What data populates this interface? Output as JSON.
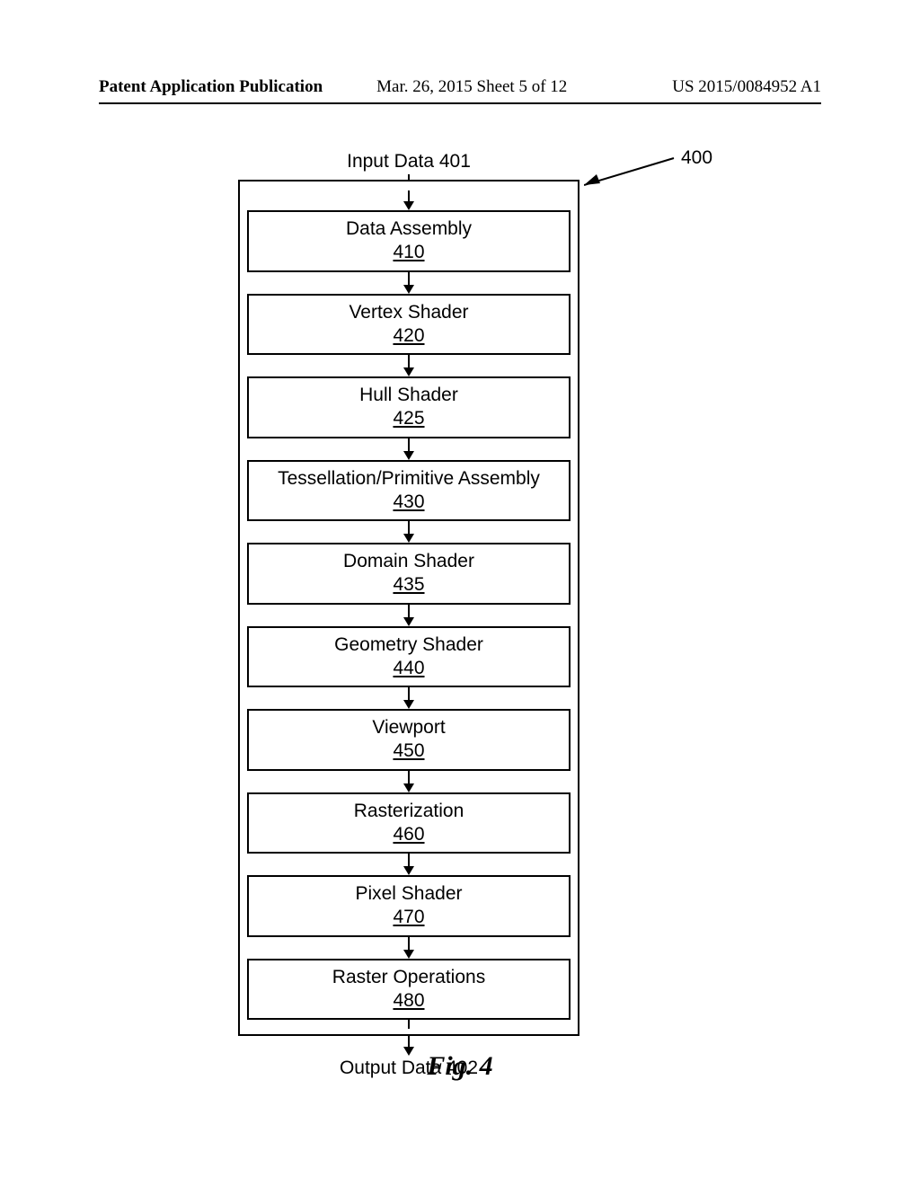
{
  "header": {
    "left": "Patent Application Publication",
    "mid": "Mar. 26, 2015  Sheet 5 of 12",
    "right": "US 2015/0084952 A1"
  },
  "diagram": {
    "input_label": "Input Data 401",
    "output_label": "Output Data 402",
    "ref_label": "400",
    "stages": [
      {
        "name": "Data Assembly",
        "num": "410"
      },
      {
        "name": "Vertex Shader",
        "num": "420"
      },
      {
        "name": "Hull Shader",
        "num": "425"
      },
      {
        "name": "Tessellation/Primitive Assembly",
        "num": "430"
      },
      {
        "name": "Domain Shader",
        "num": "435"
      },
      {
        "name": "Geometry Shader",
        "num": "440"
      },
      {
        "name": "Viewport",
        "num": "450"
      },
      {
        "name": "Rasterization",
        "num": "460"
      },
      {
        "name": "Pixel Shader",
        "num": "470"
      },
      {
        "name": "Raster Operations",
        "num": "480"
      }
    ]
  },
  "figure_caption": "Fig. 4"
}
